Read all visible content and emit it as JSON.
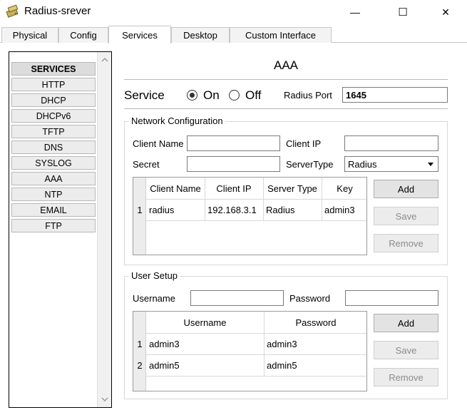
{
  "window": {
    "title": "Radius-srever",
    "minimize_glyph": "—",
    "maximize_glyph": "☐",
    "close_glyph": "✕"
  },
  "tabs": [
    {
      "label": "Physical",
      "active": false
    },
    {
      "label": "Config",
      "active": false
    },
    {
      "label": "Services",
      "active": true
    },
    {
      "label": "Desktop",
      "active": false
    },
    {
      "label": "Custom Interface",
      "active": false
    }
  ],
  "sidebar": {
    "items": [
      "SERVICES",
      "HTTP",
      "DHCP",
      "DHCPv6",
      "TFTP",
      "DNS",
      "SYSLOG",
      "AAA",
      "NTP",
      "EMAIL",
      "FTP"
    ]
  },
  "aaa": {
    "title": "AAA",
    "service_label": "Service",
    "on_label": "On",
    "off_label": "Off",
    "service_on": true,
    "radius_port_label": "Radius Port",
    "radius_port_value": "1645"
  },
  "network_config": {
    "legend": "Network Configuration",
    "client_name_label": "Client Name",
    "client_name_value": "",
    "client_ip_label": "Client IP",
    "client_ip_value": "",
    "secret_label": "Secret",
    "secret_value": "",
    "server_type_label": "ServerType",
    "server_type_value": "Radius",
    "table": {
      "columns": [
        "Client Name",
        "Client IP",
        "Server Type",
        "Key"
      ],
      "rows": [
        {
          "num": "1",
          "client_name": "radius",
          "client_ip": "192.168.3.1",
          "server_type": "Radius",
          "key": "admin3"
        }
      ]
    },
    "add_label": "Add",
    "save_label": "Save",
    "remove_label": "Remove"
  },
  "user_setup": {
    "legend": "User Setup",
    "username_label": "Username",
    "username_value": "",
    "password_label": "Password",
    "password_value": "",
    "table": {
      "columns": [
        "Username",
        "Password"
      ],
      "rows": [
        {
          "num": "1",
          "username": "admin3",
          "password": "admin3"
        },
        {
          "num": "2",
          "username": "admin5",
          "password": "admin5"
        }
      ]
    },
    "add_label": "Add",
    "save_label": "Save",
    "remove_label": "Remove"
  },
  "colors": {
    "border": "#b9b9b9",
    "disabled_text": "#8c8c8c",
    "button_bg": "#e3e3e3"
  }
}
